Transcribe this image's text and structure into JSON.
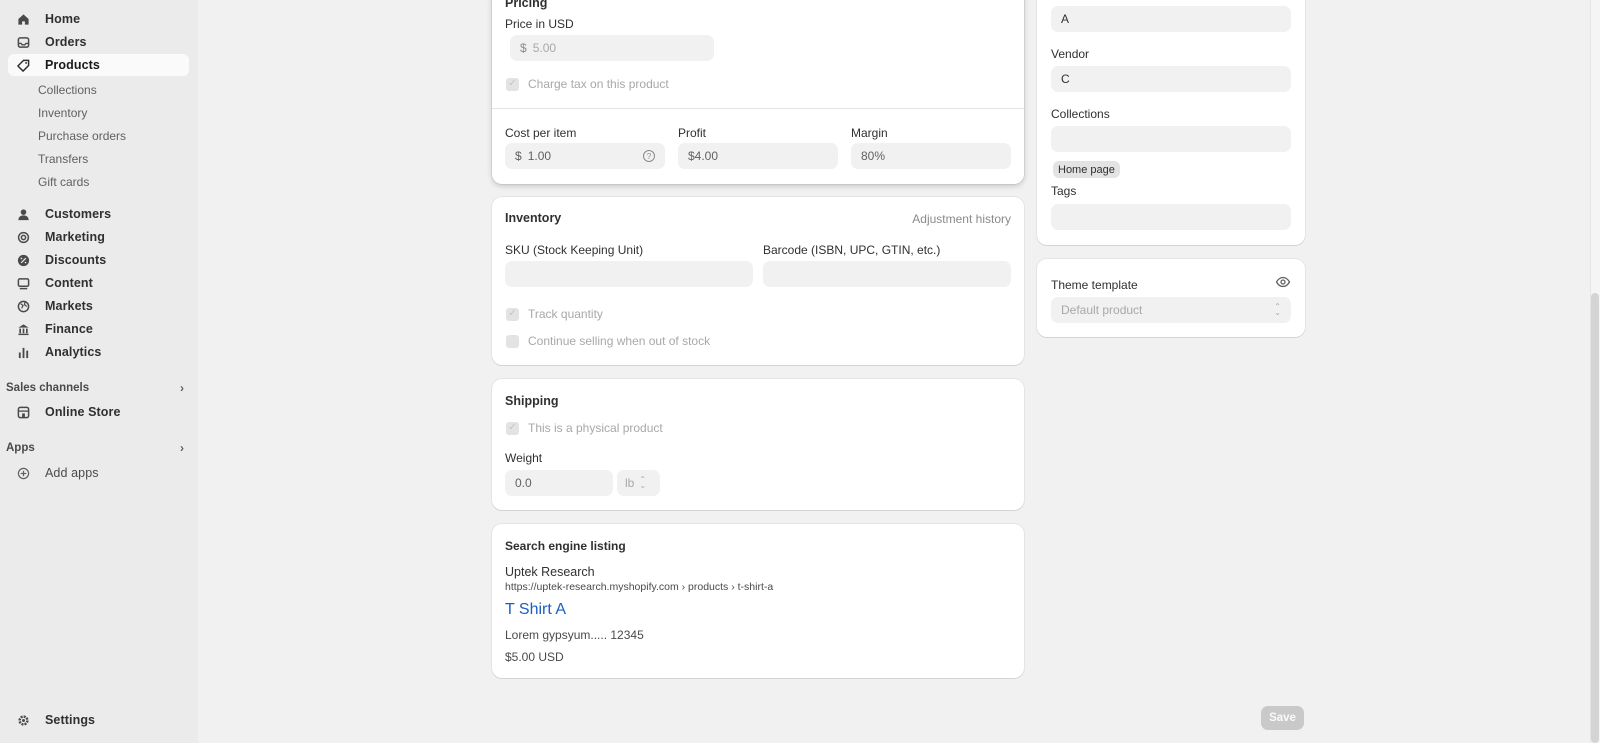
{
  "sidebar": {
    "main_items": [
      {
        "label": "Home",
        "icon": "home-icon"
      },
      {
        "label": "Orders",
        "icon": "inbox-icon"
      },
      {
        "label": "Products",
        "icon": "tag-icon"
      }
    ],
    "product_subitems": [
      "Collections",
      "Inventory",
      "Purchase orders",
      "Transfers",
      "Gift cards"
    ],
    "more_items": [
      {
        "label": "Customers",
        "icon": "person-icon"
      },
      {
        "label": "Marketing",
        "icon": "target-icon"
      },
      {
        "label": "Discounts",
        "icon": "discount-icon"
      },
      {
        "label": "Content",
        "icon": "content-icon"
      },
      {
        "label": "Markets",
        "icon": "globe-icon"
      },
      {
        "label": "Finance",
        "icon": "bank-icon"
      },
      {
        "label": "Analytics",
        "icon": "bar-chart-icon"
      }
    ],
    "sales_channels_label": "Sales channels",
    "online_store_label": "Online Store",
    "apps_label": "Apps",
    "add_apps_label": "Add apps",
    "settings_label": "Settings"
  },
  "pricing": {
    "title": "Pricing",
    "price_label": "Price in USD",
    "currency_symbol": "$",
    "price_value": "5.00",
    "charge_tax_label": "Charge tax on this product",
    "cost_label": "Cost per item",
    "cost_value": "1.00",
    "profit_label": "Profit",
    "profit_value": "$4.00",
    "margin_label": "Margin",
    "margin_value": "80%"
  },
  "inventory": {
    "title": "Inventory",
    "adjustment_history": "Adjustment history",
    "sku_label": "SKU (Stock Keeping Unit)",
    "barcode_label": "Barcode (ISBN, UPC, GTIN, etc.)",
    "track_quantity_label": "Track quantity",
    "continue_selling_label": "Continue selling when out of stock"
  },
  "shipping": {
    "title": "Shipping",
    "physical_label": "This is a physical product",
    "weight_label": "Weight",
    "weight_value": "0.0",
    "weight_unit": "lb"
  },
  "seo": {
    "title": "Search engine listing",
    "store_name": "Uptek Research",
    "url": "https://uptek-research.myshopify.com › products › t-shirt-a",
    "page_title": "T Shirt A",
    "description": "Lorem gypsyum..... 12345",
    "price": "$5.00 USD"
  },
  "organization": {
    "type_value": "A",
    "vendor_label": "Vendor",
    "vendor_value": "C",
    "collections_label": "Collections",
    "collection_tag": "Home page",
    "tags_label": "Tags"
  },
  "theme": {
    "title": "Theme template",
    "template_value": "Default product"
  },
  "save_label": "Save",
  "colors": {
    "link_blue": "#1a5fc7",
    "sidebar_bg": "#ebebeb",
    "page_bg": "#f1f1f1"
  }
}
